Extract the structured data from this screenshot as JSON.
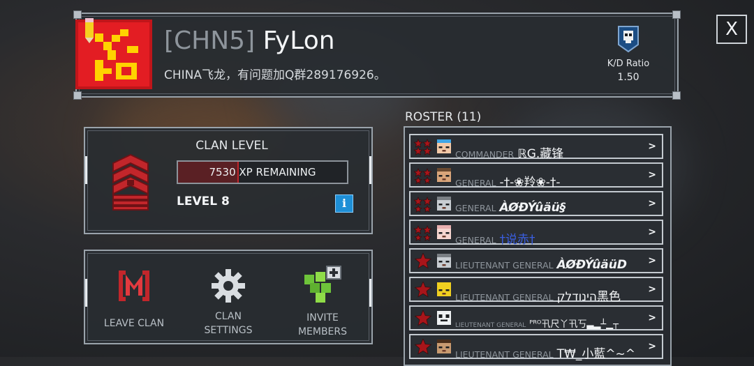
{
  "header": {
    "clan_tag": "[CHN5]",
    "clan_name": "FyLon",
    "description": "CHINA飞龙，有问题加Q群289176926。",
    "kd_label": "K/D Ratio",
    "kd_value": "1.50",
    "close_label": "X"
  },
  "level": {
    "title": "CLAN LEVEL",
    "xp_remaining": "7530 XP REMAINING",
    "xp_progress": 0.35,
    "level_label": "LEVEL 8",
    "info_label": "i"
  },
  "actions": {
    "leave": "LEAVE CLAN",
    "settings_line1": "CLAN",
    "settings_line2": "SETTINGS",
    "invite_line1": "INVITE",
    "invite_line2": "MEMBERS"
  },
  "roster": {
    "title": "ROSTER (11)",
    "members": [
      {
        "rank": "COMMANDER",
        "name": "ℝG.藏锋",
        "stars": 3,
        "face": "blue-hair-face"
      },
      {
        "rank": "GENERAL",
        "name": "-†-❀羚❀-†-",
        "stars": 2,
        "face": "tan-face"
      },
      {
        "rank": "GENERAL",
        "name": "ÀØĐÝûäü§",
        "stars": 2,
        "face": "gray-face"
      },
      {
        "rank": "GENERAL",
        "name": "†说赤†",
        "stars": 2,
        "face": "pink-face"
      },
      {
        "rank": "LIEUTENANT GENERAL",
        "name": "ÀØĐÝûäüD",
        "stars": 1,
        "face": "gray-face"
      },
      {
        "rank": "LIEUTENANT GENERAL",
        "name": "הינודלק黑色",
        "stars": 1,
        "face": "yellow-face"
      },
      {
        "rank": "LIEUTENANT GENERAL",
        "name": "ᴾᴿᴼ卂尺丫卂丂▃▂┴▁┬",
        "stars": 1,
        "face": "skull-face"
      },
      {
        "rank": "LIEUTENANT GENERAL",
        "name": "T₩_小藍^~^",
        "stars": 1,
        "face": "steve-face"
      }
    ]
  },
  "colors": {
    "accent_red": "#c2262b",
    "info_blue": "#1e8fd6",
    "invite_green": "#6ec43a"
  }
}
